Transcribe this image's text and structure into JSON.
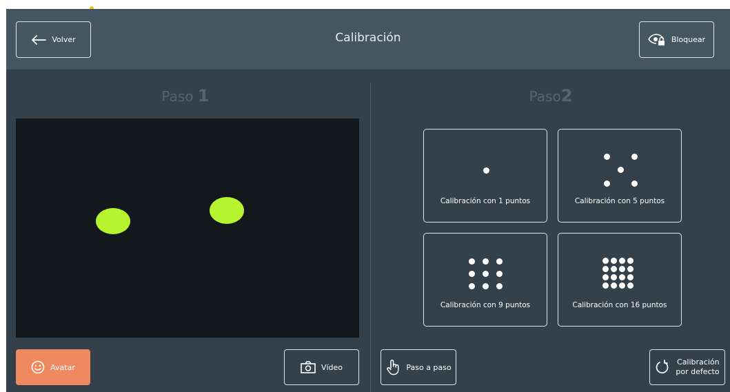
{
  "header": {
    "title": "Calibración",
    "back_label": "Volver",
    "lock_label": "Bloquear"
  },
  "step1": {
    "label": "Paso",
    "number": "1"
  },
  "step2": {
    "label": "Paso",
    "number": "2"
  },
  "calibration_options": [
    {
      "label": "Calibración con 1 puntos",
      "points": 1
    },
    {
      "label": "Calibración con 5 puntos",
      "points": 5
    },
    {
      "label": "Calibración con 9 puntos",
      "points": 9
    },
    {
      "label": "Calibración con 16 puntos",
      "points": 16
    }
  ],
  "footer": {
    "avatar_label": "Avatar",
    "video_label": "Vídeo",
    "step_by_step_label": "Paso a paso",
    "default_calibration_line1": "Calibración",
    "default_calibration_line2": "por defecto"
  },
  "icons": {
    "back": "arrow-left-icon",
    "lock": "eye-lock-icon",
    "avatar": "smiley-icon",
    "video": "camera-icon",
    "step": "hand-pointer-icon",
    "default": "reset-icon"
  },
  "colors": {
    "header_bg": "#435662",
    "app_bg": "#34414b",
    "accent": "#ef8a60",
    "eye_marker": "#b6f42f"
  }
}
